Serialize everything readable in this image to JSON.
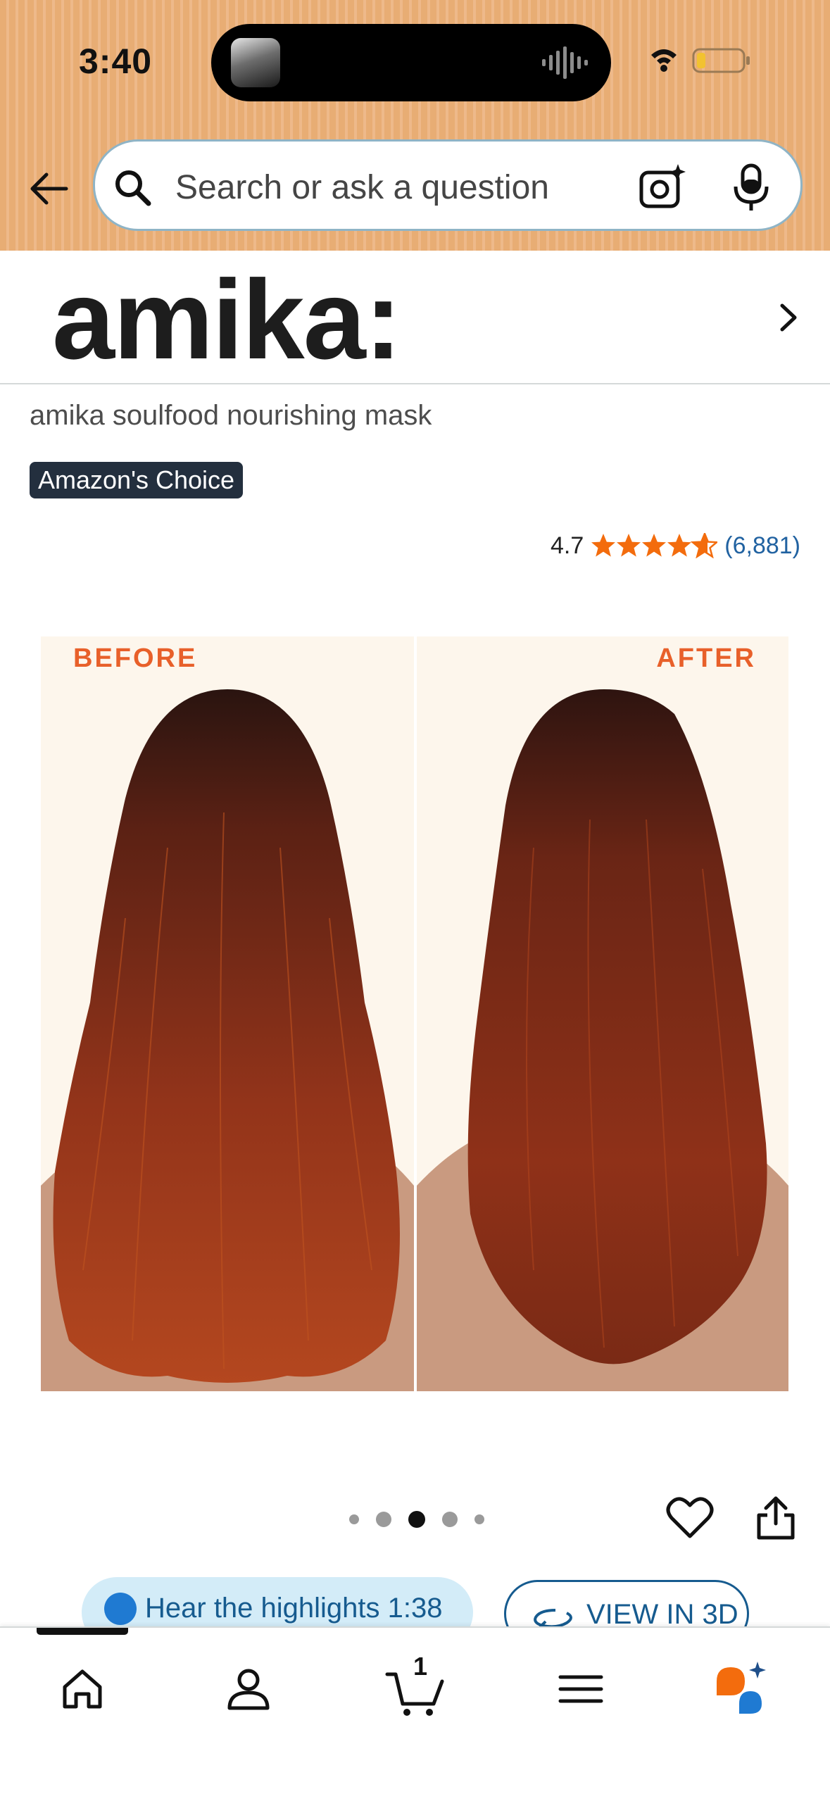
{
  "status_bar": {
    "time": "3:40"
  },
  "search": {
    "placeholder": "Search or ask a question"
  },
  "brand": {
    "logo_text": "amika:"
  },
  "product": {
    "title": "amika soulfood nourishing mask",
    "badge": "Amazon's Choice",
    "rating": "4.7",
    "stars": 4.7,
    "review_count": "(6,881)"
  },
  "gallery": {
    "before_label": "BEFORE",
    "after_label": "AFTER",
    "image_count": 5,
    "active_index": 2
  },
  "actions": {
    "hear_label": "Hear the highlights 1:38",
    "view3d_label": "VIEW IN 3D"
  },
  "bottom_nav": {
    "items": [
      "home-icon",
      "account-icon",
      "cart-icon",
      "menu-icon",
      "rufus-icon"
    ],
    "cart_count": "1"
  },
  "colors": {
    "header_bg": "#e8ad74",
    "badge_bg": "#232f3e",
    "star": "#f36c0d",
    "link": "#2162a1",
    "label_orange": "#e8602a"
  }
}
